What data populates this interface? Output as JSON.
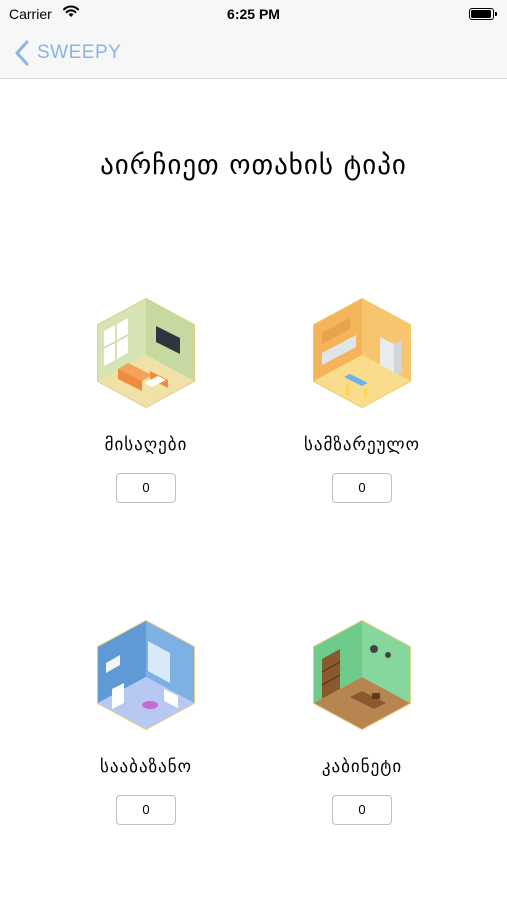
{
  "status_bar": {
    "carrier": "Carrier",
    "time": "6:25 PM"
  },
  "nav": {
    "back_label": "SWEEPY"
  },
  "page": {
    "title": "აირჩიეთ ოთახის ტიპი"
  },
  "rooms": [
    {
      "name": "მისაღები",
      "quantity": "0",
      "icon": "living-room-icon"
    },
    {
      "name": "სამზარეულო",
      "quantity": "0",
      "icon": "kitchen-icon"
    },
    {
      "name": "სააბაზანო",
      "quantity": "0",
      "icon": "bathroom-icon"
    },
    {
      "name": "კაბინეტი",
      "quantity": "0",
      "icon": "study-icon"
    }
  ],
  "colors": {
    "accent": "#8ab4e6",
    "status_bar_bg": "#f7f7f7"
  }
}
